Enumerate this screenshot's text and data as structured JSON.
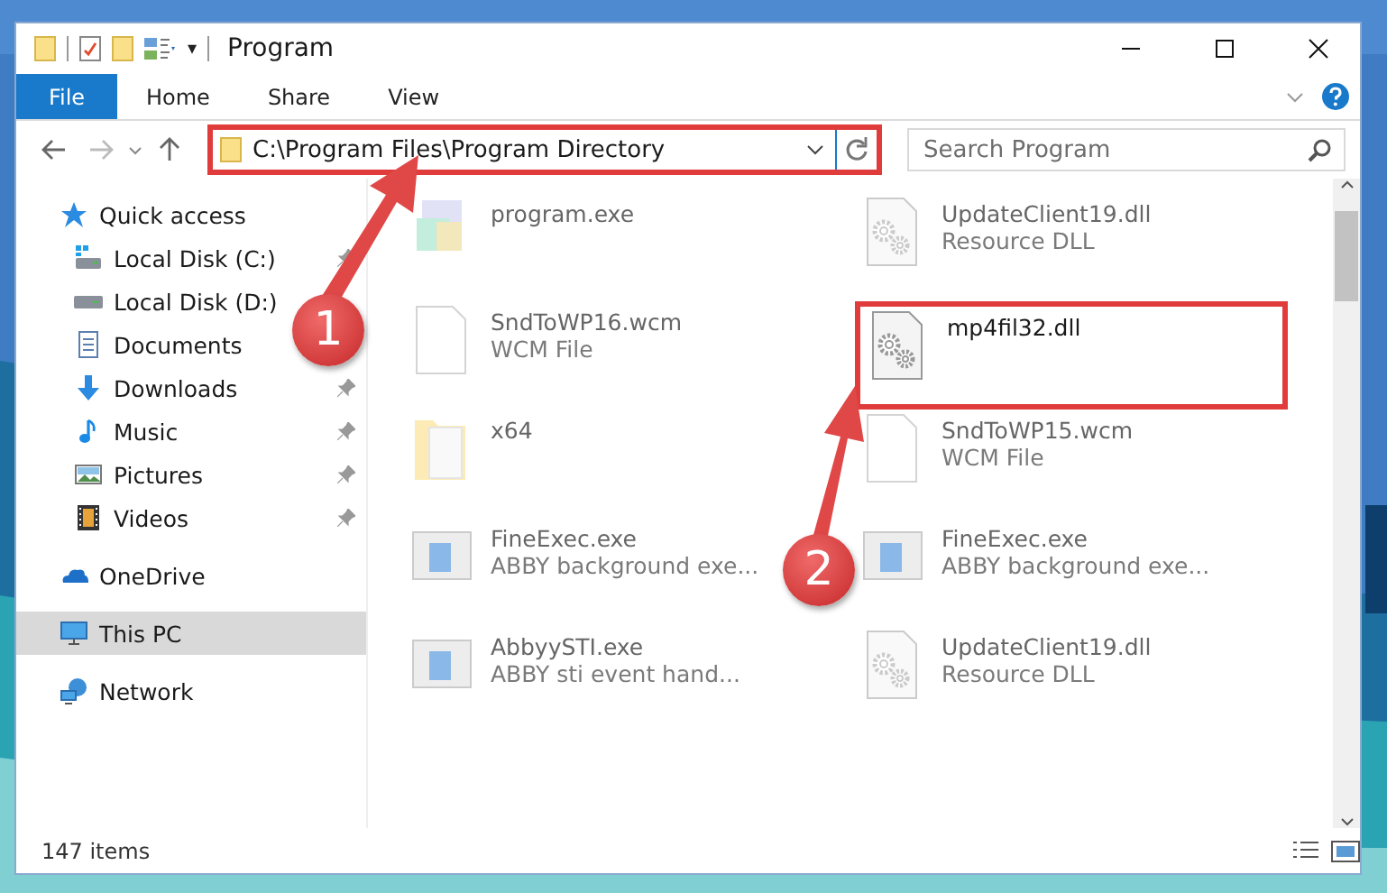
{
  "window": {
    "title": "Program"
  },
  "quick_toolbar": {
    "dropdown": "▾"
  },
  "ribbon": {
    "tabs": [
      {
        "label": "File",
        "selected": true
      },
      {
        "label": "Home",
        "selected": false
      },
      {
        "label": "Share",
        "selected": false
      },
      {
        "label": "View",
        "selected": false
      }
    ]
  },
  "address_bar": {
    "path": "C:\\Program Files\\Program Directory",
    "highlighted": true
  },
  "search": {
    "placeholder": "Search Program"
  },
  "navigation": [
    {
      "label": "Quick access",
      "selected": false,
      "children": [
        {
          "label": "Local Disk (C:)",
          "pinned": true,
          "selected": false
        },
        {
          "label": "Local Disk (D:)",
          "pinned": false,
          "selected": false
        },
        {
          "label": "Documents",
          "pinned": false,
          "selected": false
        },
        {
          "label": "Downloads",
          "pinned": true,
          "selected": false
        },
        {
          "label": "Music",
          "pinned": true,
          "selected": false
        },
        {
          "label": "Pictures",
          "pinned": true,
          "selected": false
        },
        {
          "label": "Videos",
          "pinned": true,
          "selected": false
        }
      ]
    },
    {
      "label": "OneDrive",
      "selected": false
    },
    {
      "label": "This PC",
      "selected": true
    },
    {
      "label": "Network",
      "selected": false
    }
  ],
  "files": [
    {
      "name": "program.exe",
      "kind": "exe",
      "blurred": true,
      "highlighted": false
    },
    {
      "name": "UpdateClient19.dll",
      "type": "Resource DLL",
      "kind": "dll",
      "blurred": true,
      "highlighted": false
    },
    {
      "name": "SndToWP16.wcm",
      "type": "WCM File",
      "kind": "doc",
      "blurred": true,
      "highlighted": false
    },
    {
      "name": "mp4fil32.dll",
      "kind": "dll",
      "blurred": false,
      "highlighted": true
    },
    {
      "name": "x64",
      "kind": "folder",
      "blurred": true,
      "highlighted": false
    },
    {
      "name": "SndToWP15.wcm",
      "type": "WCM File",
      "kind": "doc",
      "blurred": true,
      "highlighted": false
    },
    {
      "name": "FineExec.exe",
      "type": "ABBY background exe...",
      "kind": "app",
      "blurred": true,
      "highlighted": false
    },
    {
      "name": "FineExec.exe",
      "type": "ABBY background exe...",
      "kind": "app",
      "blurred": true,
      "highlighted": false
    },
    {
      "name": "AbbyySTI.exe",
      "type": "ABBY sti event hand...",
      "kind": "app",
      "blurred": true,
      "highlighted": false
    },
    {
      "name": "UpdateClient19.dll",
      "type": "Resource DLL",
      "kind": "dll",
      "blurred": true,
      "highlighted": false
    }
  ],
  "status_bar": {
    "item_count": "147 items"
  },
  "annotations": [
    {
      "label": "1"
    },
    {
      "label": "2"
    }
  ]
}
